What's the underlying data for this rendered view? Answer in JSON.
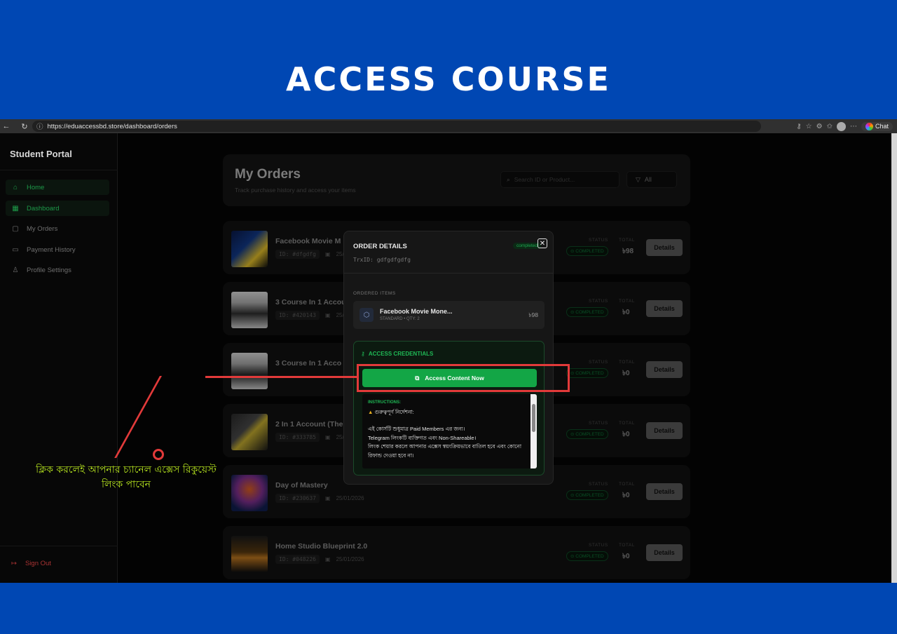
{
  "banner": {
    "title": "ACCESS COURSE"
  },
  "browser": {
    "url": "https://eduaccessbd.store/dashboard/orders",
    "chat_label": "Chat"
  },
  "sidebar": {
    "brand": "Student Portal",
    "items": [
      {
        "label": "Home",
        "icon": "home-icon",
        "glyph": "⌂"
      },
      {
        "label": "Dashboard",
        "icon": "grid-icon",
        "glyph": "▦"
      },
      {
        "label": "My Orders",
        "icon": "book-icon",
        "glyph": "▢"
      },
      {
        "label": "Payment History",
        "icon": "card-icon",
        "glyph": "▭"
      },
      {
        "label": "Profile Settings",
        "icon": "user-icon",
        "glyph": "♙"
      }
    ],
    "signout": "Sign Out"
  },
  "header": {
    "title": "My Orders",
    "subtitle": "Track purchase history and access your items",
    "search_placeholder": "Search ID or Product...",
    "filter_label": "All"
  },
  "orders": [
    {
      "name": "Facebook Movie M",
      "id": "#dfgdfg",
      "date": "25/0",
      "status": "COMPLETED",
      "total": "৳98"
    },
    {
      "name": "3 Course In 1 Accou",
      "id": "#420143",
      "date": "25/01",
      "status": "COMPLETED",
      "total": "৳0"
    },
    {
      "name": "3 Course In 1 Acco",
      "id": "",
      "date": "",
      "status": "COMPLETED",
      "total": "৳0"
    },
    {
      "name": "2 In 1 Account (The",
      "id": "#333785",
      "date": "25/0",
      "status": "COMPLETED",
      "total": "৳0"
    },
    {
      "name": "Day of Mastery",
      "id": "#230637",
      "date": "25/01/2026",
      "status": "COMPLETED",
      "total": "৳0"
    },
    {
      "name": "Home Studio Blueprint 2.0",
      "id": "#048226",
      "date": "25/01/2026",
      "status": "COMPLETED",
      "total": "৳0"
    }
  ],
  "labels": {
    "status": "STATUS",
    "total": "TOTAL",
    "details": "Details",
    "id_prefix": "ID:"
  },
  "modal": {
    "title": "ORDER DETAILS",
    "trx": "TrxID: gdfgdfgdfg",
    "tag": "completed",
    "ordered_items_label": "ORDERED ITEMS",
    "item": {
      "name": "Facebook Movie Mone...",
      "meta": "STANDARD  •  QTY: 2",
      "price": "৳98"
    },
    "credentials_title": "ACCESS CREDENTIALS",
    "access_button": "Access Content Now",
    "instructions_label": "INSTRUCTIONS:",
    "instructions": [
      "গুরুত্বপূর্ণ নির্দেশনা:",
      "এই কোর্সটি শুধুমাত্র Paid Members এর জন্য।",
      "Telegram লিংকটি ব্যক্তিগত এবং Non-Shareable।",
      "লিংক শেয়ার করলে আপনার এক্সেস স্বয়ংক্রিয়ভাবে বাতিল হবে এবং কোনো",
      "রিফান্ড দেওয়া হবে না।"
    ]
  },
  "annotation": {
    "line1": "ক্লিক করলেই আপনার চ্যানেল এক্সেস রিকুয়েস্ট",
    "line2": "লিংক পাবেন",
    "color": "#e23a3a"
  }
}
